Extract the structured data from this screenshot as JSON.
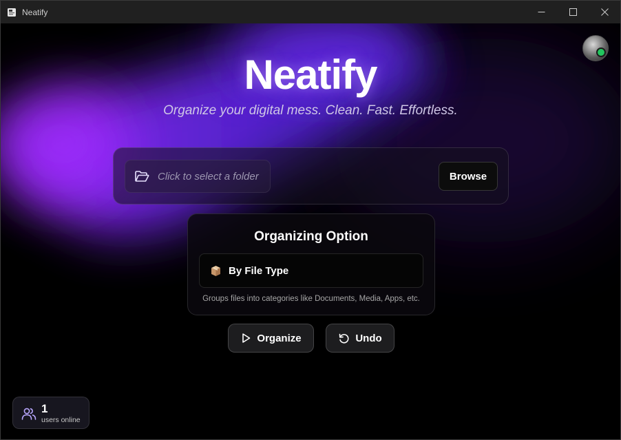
{
  "window": {
    "title": "Neatify",
    "controls": [
      "minimize",
      "maximize",
      "close"
    ]
  },
  "header": {
    "app_name": "Neatify",
    "tagline": "Organize your digital mess. Clean. Fast. Effortless."
  },
  "folder_picker": {
    "placeholder": "Click to select a folder",
    "browse_label": "Browse",
    "icon": "folder-open-icon"
  },
  "organizing": {
    "title": "Organizing Option",
    "selected_option": "By File Type",
    "option_icon": "package-box-icon",
    "description": "Groups files into categories like Documents, Media, Apps, etc."
  },
  "actions": {
    "organize_label": "Organize",
    "undo_label": "Undo"
  },
  "presence": {
    "count": "1",
    "label": "users online",
    "status_color": "#22c55e"
  },
  "colors": {
    "accent_purple": "#7a2cff",
    "background": "#000000"
  }
}
